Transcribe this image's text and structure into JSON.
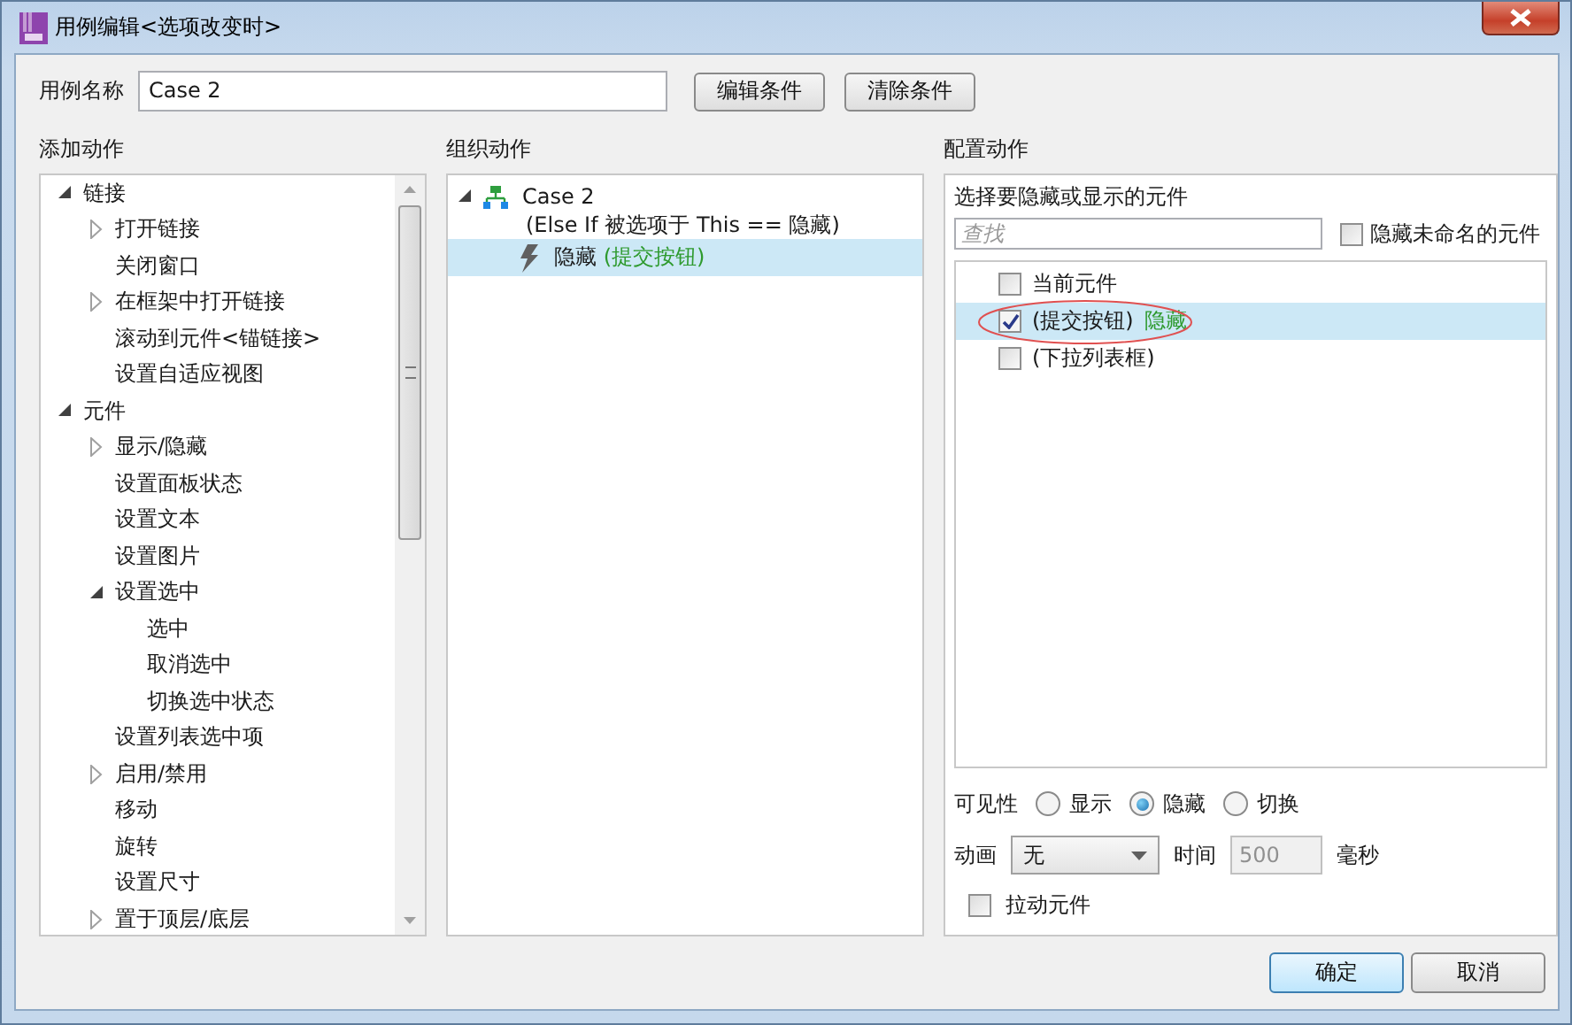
{
  "window": {
    "title": "用例编辑<选项改变时>"
  },
  "case_name": {
    "label": "用例名称",
    "value": "Case 2"
  },
  "header_buttons": [
    "编辑条件",
    "清除条件"
  ],
  "add_actions": {
    "heading": "添加动作",
    "tree": [
      {
        "label": "链接",
        "expanded": true,
        "children": [
          {
            "label": "打开链接",
            "expanded": false
          },
          {
            "label": "关闭窗口"
          },
          {
            "label": "在框架中打开链接",
            "expanded": false
          },
          {
            "label": "滚动到元件<锚链接>"
          },
          {
            "label": "设置自适应视图"
          }
        ]
      },
      {
        "label": "元件",
        "expanded": true,
        "children": [
          {
            "label": "显示/隐藏",
            "expanded": false
          },
          {
            "label": "设置面板状态"
          },
          {
            "label": "设置文本"
          },
          {
            "label": "设置图片"
          },
          {
            "label": "设置选中",
            "expanded": true,
            "children": [
              {
                "label": "选中"
              },
              {
                "label": "取消选中"
              },
              {
                "label": "切换选中状态"
              }
            ]
          },
          {
            "label": "设置列表选中项"
          },
          {
            "label": "启用/禁用",
            "expanded": false
          },
          {
            "label": "移动"
          },
          {
            "label": "旋转"
          },
          {
            "label": "设置尺寸"
          },
          {
            "label": "置于顶层/底层",
            "expanded": false
          }
        ]
      }
    ]
  },
  "organize_actions": {
    "heading": "组织动作",
    "case": {
      "label": "Case 2",
      "condition": "(Else If 被选项于 This == 隐藏)",
      "expanded": true,
      "actions": [
        {
          "verb": "隐藏",
          "target": "(提交按钮)",
          "selected": true
        }
      ]
    }
  },
  "configure_actions": {
    "heading": "配置动作",
    "prompt": "选择要隐藏或显示的元件",
    "search": {
      "placeholder": "查找"
    },
    "hide_unnamed": {
      "label": "隐藏未命名的元件",
      "checked": false
    },
    "widgets": [
      {
        "label": "当前元件",
        "checked": false,
        "selected": false,
        "circled": false
      },
      {
        "label": "(提交按钮)",
        "status": "隐藏",
        "checked": true,
        "selected": true,
        "circled": true
      },
      {
        "label": "(下拉列表框)",
        "checked": false,
        "selected": false,
        "circled": false
      }
    ],
    "visibility": {
      "label": "可见性",
      "options": [
        {
          "label": "显示",
          "selected": false
        },
        {
          "label": "隐藏",
          "selected": true
        },
        {
          "label": "切换",
          "selected": false
        }
      ]
    },
    "animation": {
      "label": "动画",
      "value": "无",
      "time_label": "时间",
      "time_value": "500",
      "time_disabled": true,
      "unit": "毫秒"
    },
    "drag_widget": {
      "label": "拉动元件",
      "checked": false
    }
  },
  "footer_buttons": [
    {
      "label": "确定",
      "default": true
    },
    {
      "label": "取消",
      "default": false
    }
  ]
}
